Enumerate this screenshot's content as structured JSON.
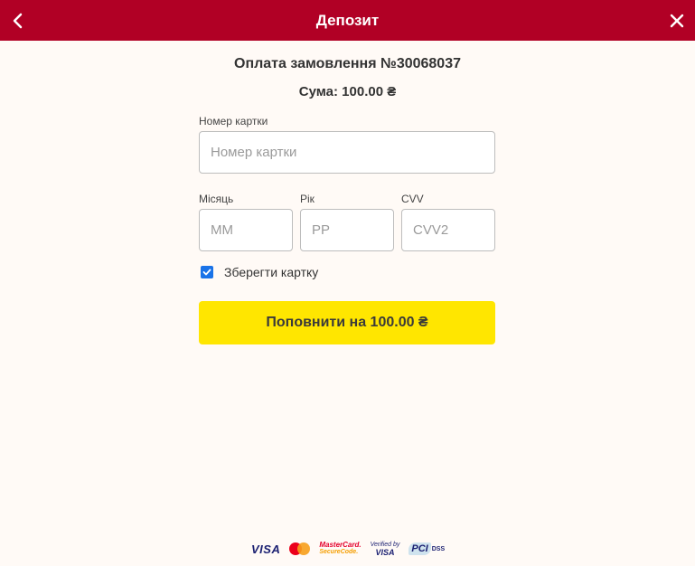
{
  "header": {
    "title": "Депозит"
  },
  "order": {
    "title": "Оплата замовлення №30068037",
    "sum": "Сума: 100.00 ₴"
  },
  "card": {
    "number_label": "Номер картки",
    "number_placeholder": "Номер картки",
    "month_label": "Місяць",
    "month_placeholder": "ММ",
    "year_label": "Рік",
    "year_placeholder": "РР",
    "cvv_label": "CVV",
    "cvv_placeholder": "CVV2"
  },
  "save_card": {
    "label": "Зберегти картку",
    "checked": true
  },
  "submit": {
    "label": "Поповнити на 100.00 ₴"
  },
  "payment_logos": {
    "visa": "VISA",
    "mc_securecode_line1": "MasterCard.",
    "mc_securecode_line2": "SecureCode.",
    "verified_line1": "Verified by",
    "verified_line2": "VISA",
    "pci": "PCI",
    "dss": "DSS"
  },
  "colors": {
    "header": "#b10025",
    "accent": "#ffe600",
    "background": "#fffaf6",
    "checkbox": "#1a73e8"
  }
}
